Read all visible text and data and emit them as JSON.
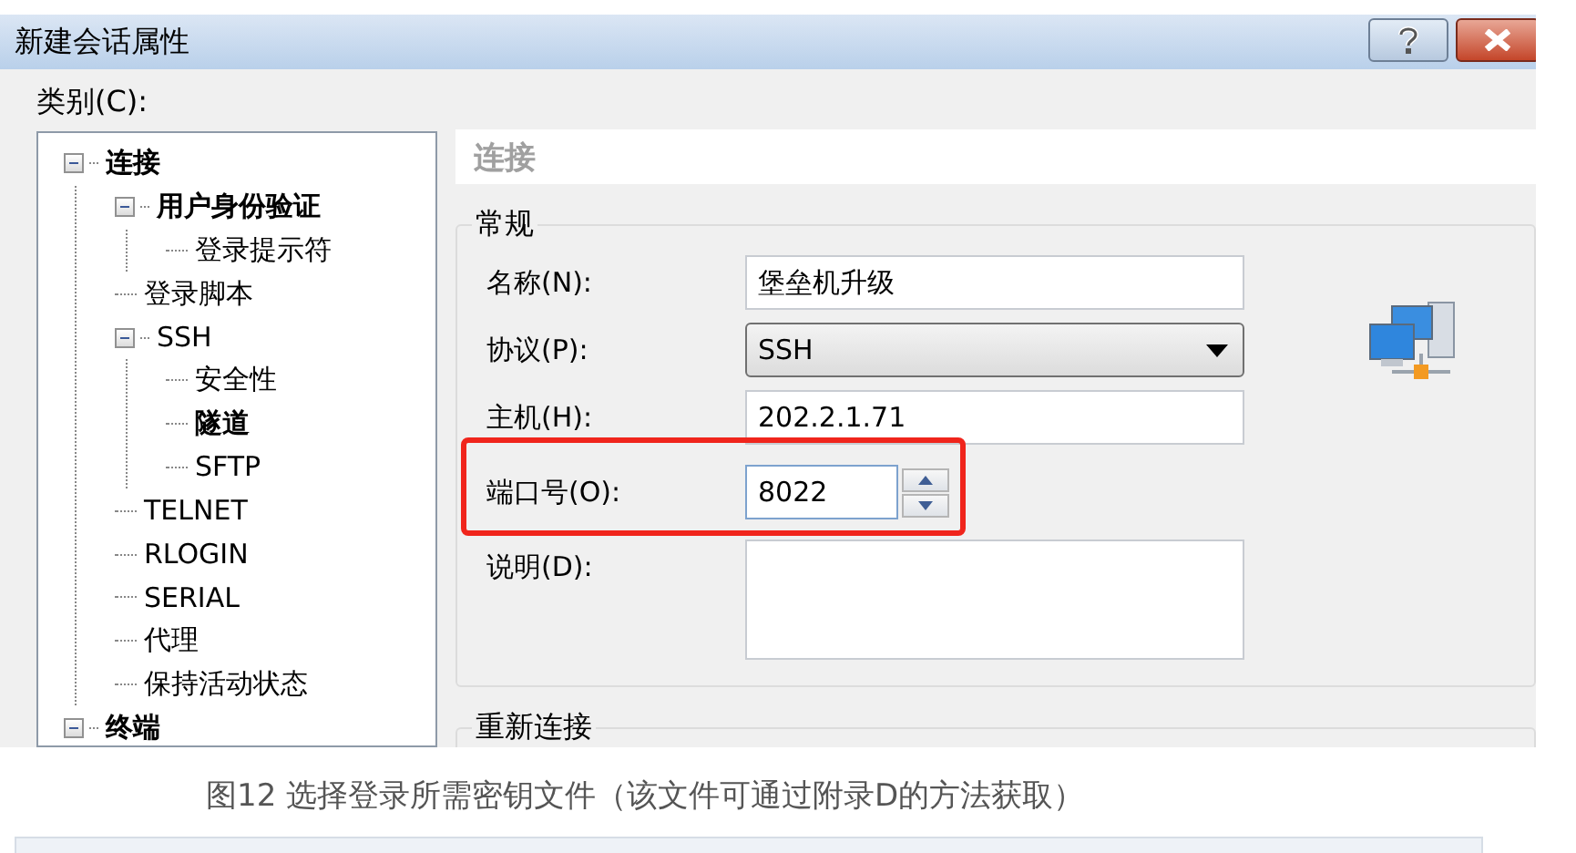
{
  "window": {
    "title": "新建会话属性"
  },
  "category_label": "类别(C):",
  "tree": [
    {
      "label": "连接",
      "bold": true,
      "expanded": true,
      "children": [
        {
          "label": "用户身份验证",
          "bold": true,
          "expanded": true,
          "children": [
            {
              "label": "登录提示符",
              "bold": false
            }
          ]
        },
        {
          "label": "登录脚本",
          "bold": false
        },
        {
          "label": "SSH",
          "bold": false,
          "expanded": true,
          "children": [
            {
              "label": "安全性",
              "bold": false
            },
            {
              "label": "隧道",
              "bold": true
            },
            {
              "label": "SFTP",
              "bold": false
            }
          ]
        },
        {
          "label": "TELNET",
          "bold": false
        },
        {
          "label": "RLOGIN",
          "bold": false
        },
        {
          "label": "SERIAL",
          "bold": false
        },
        {
          "label": "代理",
          "bold": false
        },
        {
          "label": "保持活动状态",
          "bold": false
        }
      ]
    },
    {
      "label": "终端",
      "bold": true,
      "expanded": true
    }
  ],
  "panel": {
    "heading": "连接",
    "general": {
      "legend": "常规",
      "fields": [
        {
          "kind": "text",
          "label": "名称(N):",
          "value": "堡垒机升级",
          "highlighted": false
        },
        {
          "kind": "dropdown",
          "label": "协议(P):",
          "value": "SSH",
          "highlighted": false
        },
        {
          "kind": "text",
          "label": "主机(H):",
          "value": "202.2.1.71",
          "highlighted": false
        },
        {
          "kind": "spinner",
          "label": "端口号(O):",
          "value": "8022",
          "highlighted": true
        },
        {
          "kind": "textarea",
          "label": "说明(D):",
          "highlighted": false
        }
      ]
    },
    "reconnect": {
      "legend": "重新连接"
    }
  },
  "caption": "图12 选择登录所需密钥文件（该文件可通过附录D的方法获取）"
}
